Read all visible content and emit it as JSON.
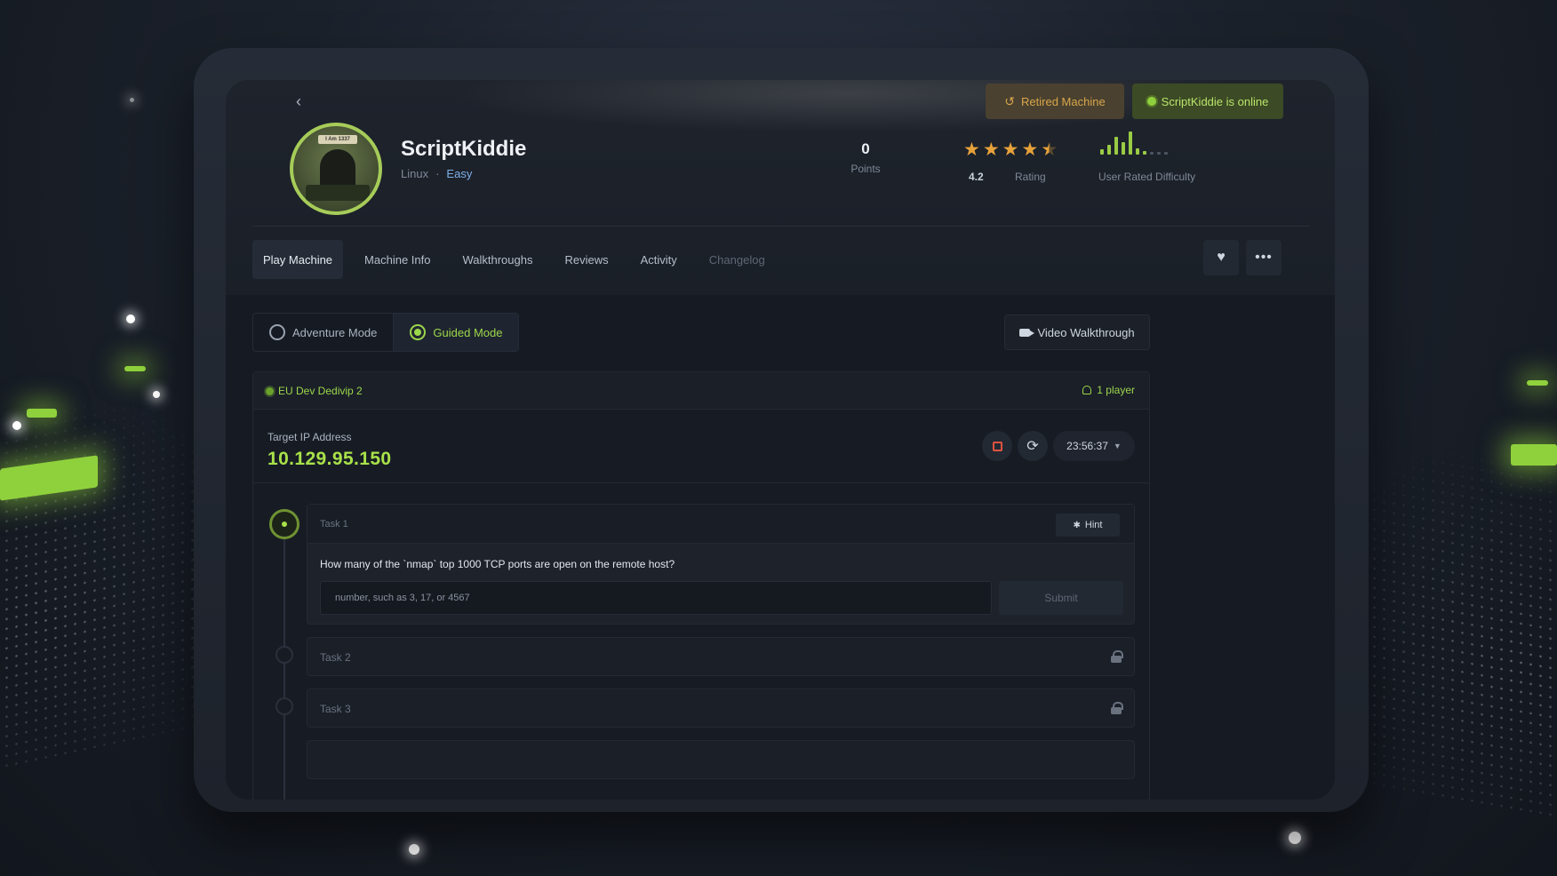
{
  "machine": {
    "name": "ScriptKiddie",
    "os": "Linux",
    "separator": "·",
    "difficulty": "Easy",
    "avatar_text": "I Am 1337"
  },
  "badges": {
    "retired": "Retired Machine",
    "online": "ScriptKiddie is online"
  },
  "stats": {
    "points_value": "0",
    "points_label": "Points",
    "rating_value": "4.2",
    "rating_label": "Rating",
    "rating_stars": 4.2,
    "difficulty_label": "User Rated Difficulty"
  },
  "tabs": [
    {
      "label": "Play Machine"
    },
    {
      "label": "Machine Info"
    },
    {
      "label": "Walkthroughs"
    },
    {
      "label": "Reviews"
    },
    {
      "label": "Activity"
    },
    {
      "label": "Changelog"
    }
  ],
  "modes": {
    "adventure": "Adventure Mode",
    "guided": "Guided Mode",
    "selected": "guided"
  },
  "video_walkthrough": "Video Walkthrough",
  "server": {
    "name": "EU Dev Dedivip 2",
    "players": "1 player"
  },
  "target": {
    "label": "Target IP Address",
    "ip": "10.129.95.150",
    "timer": "23:56:37"
  },
  "tasks": [
    {
      "title": "Task 1",
      "hint": "Hint",
      "question": "How many of the `nmap` top 1000 TCP ports are open on the remote host?",
      "placeholder": "number, such as 3, 17, or 4567",
      "submit": "Submit"
    },
    {
      "title": "Task 2",
      "locked": true
    },
    {
      "title": "Task 3",
      "locked": true
    }
  ],
  "colors": {
    "accent_green": "#a8e14a",
    "retired_amber": "#d8a64a",
    "star": "#e8a23a",
    "stop_red": "#e0533f"
  }
}
